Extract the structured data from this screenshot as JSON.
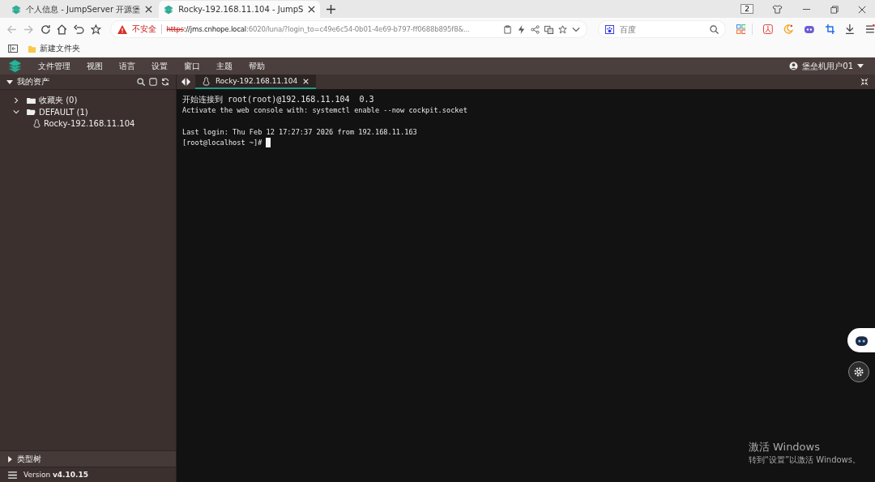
{
  "browser": {
    "tabs": [
      {
        "title": "个人信息 - JumpServer 开源堡",
        "selected": false
      },
      {
        "title": "Rocky-192.168.11.104 - JumpS",
        "selected": true
      }
    ],
    "tab_count": "2",
    "security": "不安全",
    "url": {
      "scheme": "https",
      "rest": "://jms.cnhope.local",
      "port": ":6020/luna/?login_to=c49e6c54-0b01-4e69-b797-ff0688b895f8&..."
    },
    "search": {
      "placeholder": "百度"
    },
    "bookmarks": [
      "新建文件夹"
    ]
  },
  "app": {
    "menu": [
      "文件管理",
      "视图",
      "语言",
      "设置",
      "窗口",
      "主题",
      "帮助"
    ],
    "user": "堡垒机用户01",
    "sidebar": {
      "title": "我的资产",
      "tree": [
        {
          "label": "收藏夹 (0)",
          "expanded": false,
          "kind": "folder"
        },
        {
          "label": "DEFAULT (1)",
          "expanded": true,
          "kind": "folder",
          "children": [
            {
              "label": "Rocky-192.168.11.104",
              "kind": "linux"
            }
          ]
        }
      ],
      "type_tree": "类型树",
      "version": "Version **v4.10.15**"
    },
    "session_tabs": [
      {
        "title": "Rocky-192.168.11.104",
        "selected": true
      }
    ],
    "terminal": {
      "lines": [
        {
          "text": "开始连接到 root(root)@192.168.11.104  0.3",
          "cursor": false
        },
        {
          "text": "Activate the web console with: systemctl enable --now cockpit.socket",
          "cursor": false
        },
        {
          "text": "Last login: Thu Feb 12 17:27:37 2026 from 192.168.11.163",
          "cursor": false,
          "blank_before": true
        },
        {
          "text": "[root@localhost ~]# ",
          "cursor": true
        }
      ]
    }
  },
  "os_notice": {
    "title": "激活 Windows",
    "text": "转到“设置”以激活 Windows。"
  }
}
